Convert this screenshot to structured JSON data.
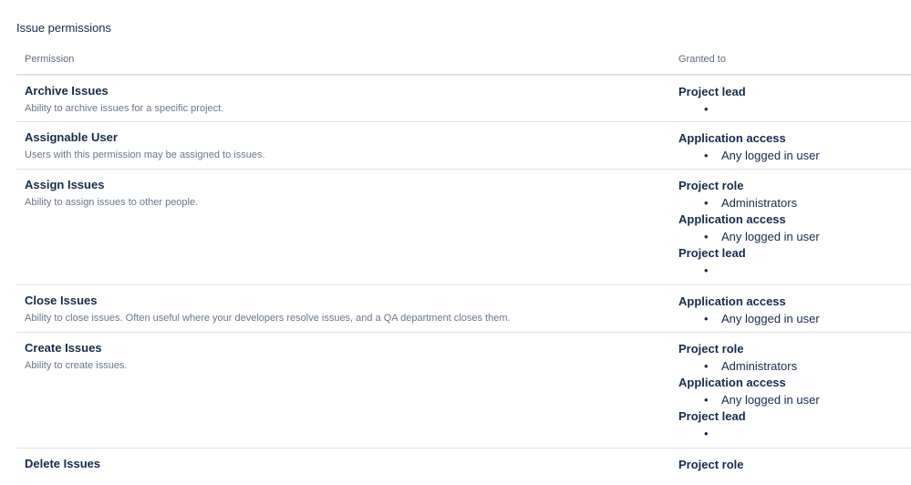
{
  "section_title": "Issue permissions",
  "table": {
    "headers": {
      "permission": "Permission",
      "granted_to": "Granted to"
    },
    "rows": [
      {
        "name": "Archive Issues",
        "description": "Ability to archive issues for a specific project.",
        "grants": [
          {
            "type": "Project lead",
            "items": [
              ""
            ]
          }
        ]
      },
      {
        "name": "Assignable User",
        "description": "Users with this permission may be assigned to issues.",
        "grants": [
          {
            "type": "Application access",
            "items": [
              "Any logged in user"
            ]
          }
        ]
      },
      {
        "name": "Assign Issues",
        "description": "Ability to assign issues to other people.",
        "grants": [
          {
            "type": "Project role",
            "items": [
              "Administrators"
            ]
          },
          {
            "type": "Application access",
            "items": [
              "Any logged in user"
            ]
          },
          {
            "type": "Project lead",
            "items": [
              ""
            ]
          }
        ]
      },
      {
        "name": "Close Issues",
        "description": "Ability to close issues. Often useful where your developers resolve issues, and a QA department closes them.",
        "grants": [
          {
            "type": "Application access",
            "items": [
              "Any logged in user"
            ]
          }
        ]
      },
      {
        "name": "Create Issues",
        "description": "Ability to create issues.",
        "grants": [
          {
            "type": "Project role",
            "items": [
              "Administrators"
            ]
          },
          {
            "type": "Application access",
            "items": [
              "Any logged in user"
            ]
          },
          {
            "type": "Project lead",
            "items": [
              ""
            ]
          }
        ]
      },
      {
        "name": "Delete Issues",
        "description": "",
        "grants": [
          {
            "type": "Project role",
            "items": []
          }
        ]
      }
    ]
  }
}
